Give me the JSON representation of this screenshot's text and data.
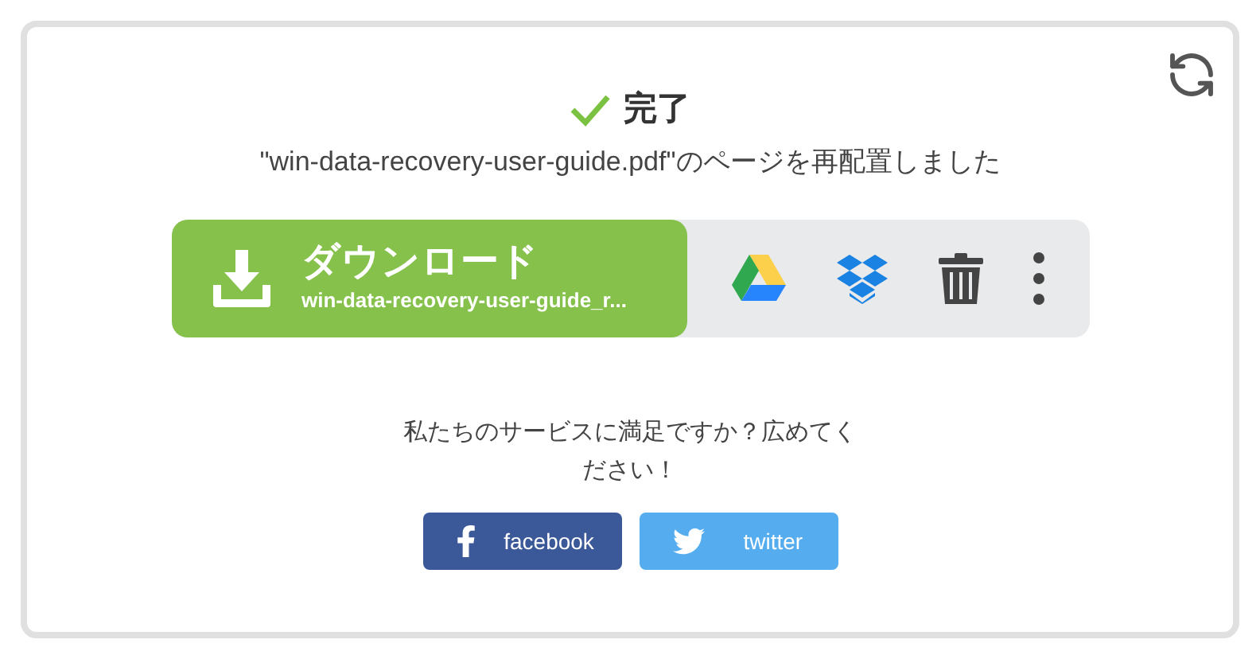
{
  "status": {
    "title": "完了",
    "message": "\"win-data-recovery-user-guide.pdf\"のページを再配置しました"
  },
  "download": {
    "label": "ダウンロード",
    "filename": "win-data-recovery-user-guide_r..."
  },
  "share": {
    "prompt": "私たちのサービスに満足ですか？広めてください！",
    "buttons": [
      {
        "kind": "facebook",
        "label": "facebook"
      },
      {
        "kind": "twitter",
        "label": "twitter"
      }
    ]
  }
}
